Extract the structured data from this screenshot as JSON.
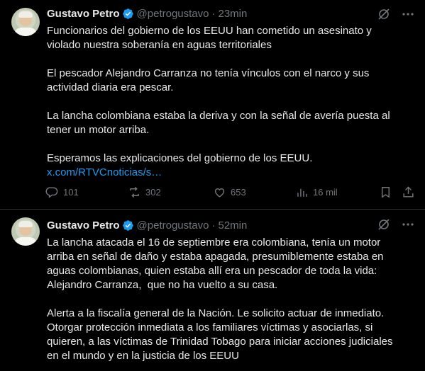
{
  "colors": {
    "background": "#000000",
    "text": "#e7e9ea",
    "muted": "#71767b",
    "link": "#1d9bf0",
    "verified": "#1d9bf0",
    "divider": "#2f3336"
  },
  "tweets": [
    {
      "author": "Gustavo Petro",
      "handle": "@petrogustavo",
      "dot": "·",
      "time": "23min",
      "paragraphs": [
        "Funcionarios del gobierno de los EEUU han cometido un asesinato y\nviolado nuestra soberanía en aguas territoriales",
        "El pescador Alejandro Carranza no tenía vínculos con el narco y sus\nactividad diaria era pescar.",
        "La lancha colombiana estaba la deriva y con la señal de avería puesta al\ntener un motor arriba.",
        "Esperamos las explicaciones del gobierno de los EEUU."
      ],
      "link": "x.com/RTVCnoticias/s…",
      "stats": {
        "replies": "101",
        "reposts": "302",
        "likes": "653",
        "views": "16 mil"
      }
    },
    {
      "author": "Gustavo Petro",
      "handle": "@petrogustavo",
      "dot": "·",
      "time": "52min",
      "paragraphs": [
        "La lancha atacada el 16 de septiembre era colombiana, tenía un motor\narriba en señal de daño y estaba apagada, presumiblemente estaba en\naguas colombianas, quien estaba allí era un pescador de toda la vida:\nAlejandro Carranza,  que no ha vuelto a su casa.",
        "Alerta a la fiscalía general de la Nación. Le solicito actuar de inmediato.\nOtorgar protección inmediata a los familiares víctimas y asociarlas, si\nquieren, a las víctimas de Trinidad Tobago para iniciar acciones judiciales\nen el mundo y en la justicia de los EEUU"
      ]
    }
  ],
  "icons": {
    "verified": "verified-badge-icon",
    "grok": "grok-icon",
    "more": "more-icon",
    "reply": "reply-icon",
    "repost": "repost-icon",
    "like": "like-icon",
    "views": "views-icon",
    "bookmark": "bookmark-icon",
    "share": "share-icon"
  }
}
